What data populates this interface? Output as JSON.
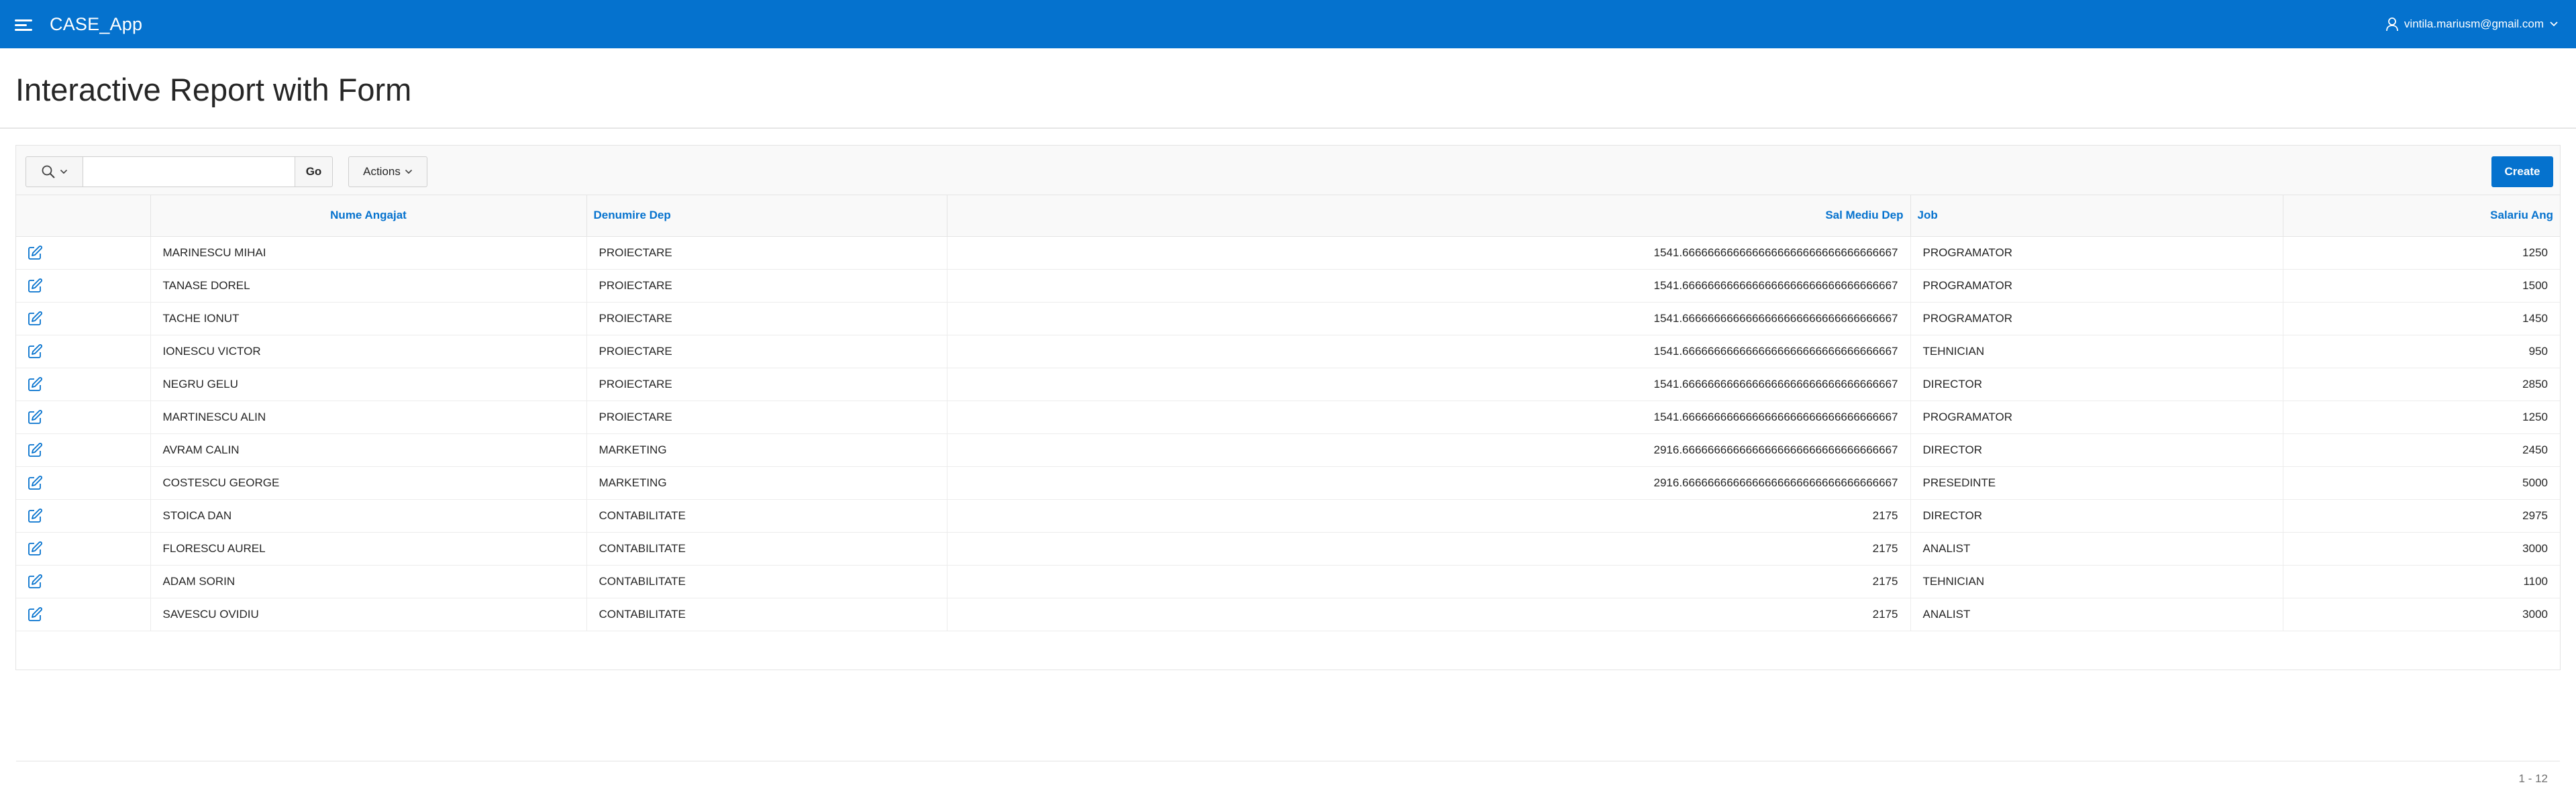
{
  "app": {
    "title": "CASE_App"
  },
  "user": {
    "email": "vintila.mariusm@gmail.com"
  },
  "page": {
    "title": "Interactive Report with Form"
  },
  "toolbar": {
    "search_value": "",
    "go_label": "Go",
    "actions_label": "Actions",
    "create_label": "Create"
  },
  "table": {
    "columns": [
      "Nume Angajat",
      "Denumire Dep",
      "Sal Mediu Dep",
      "Job",
      "Salariu Ang"
    ],
    "rows": [
      [
        "MARINESCU MIHAI",
        "PROIECTARE",
        "1541.6666666666666666666666666666666667",
        "PROGRAMATOR",
        "1250"
      ],
      [
        "TANASE DOREL",
        "PROIECTARE",
        "1541.6666666666666666666666666666666667",
        "PROGRAMATOR",
        "1500"
      ],
      [
        "TACHE IONUT",
        "PROIECTARE",
        "1541.6666666666666666666666666666666667",
        "PROGRAMATOR",
        "1450"
      ],
      [
        "IONESCU VICTOR",
        "PROIECTARE",
        "1541.6666666666666666666666666666666667",
        "TEHNICIAN",
        "950"
      ],
      [
        "NEGRU GELU",
        "PROIECTARE",
        "1541.6666666666666666666666666666666667",
        "DIRECTOR",
        "2850"
      ],
      [
        "MARTINESCU ALIN",
        "PROIECTARE",
        "1541.6666666666666666666666666666666667",
        "PROGRAMATOR",
        "1250"
      ],
      [
        "AVRAM CALIN",
        "MARKETING",
        "2916.6666666666666666666666666666666667",
        "DIRECTOR",
        "2450"
      ],
      [
        "COSTESCU GEORGE",
        "MARKETING",
        "2916.6666666666666666666666666666666667",
        "PRESEDINTE",
        "5000"
      ],
      [
        "STOICA DAN",
        "CONTABILITATE",
        "2175",
        "DIRECTOR",
        "2975"
      ],
      [
        "FLORESCU AUREL",
        "CONTABILITATE",
        "2175",
        "ANALIST",
        "3000"
      ],
      [
        "ADAM SORIN",
        "CONTABILITATE",
        "2175",
        "TEHNICIAN",
        "1100"
      ],
      [
        "SAVESCU OVIDIU",
        "CONTABILITATE",
        "2175",
        "ANALIST",
        "3000"
      ]
    ]
  },
  "pagination": {
    "label": "1 - 12"
  },
  "colors": {
    "brand": "#0572ce",
    "header_bg": "#f9f9f9",
    "border": "#e4e4e4"
  },
  "icons": {
    "menu": "hamburger-icon",
    "user": "user-icon",
    "search": "search-icon",
    "edit": "edit-icon",
    "chevron": "chevron-down-icon"
  }
}
